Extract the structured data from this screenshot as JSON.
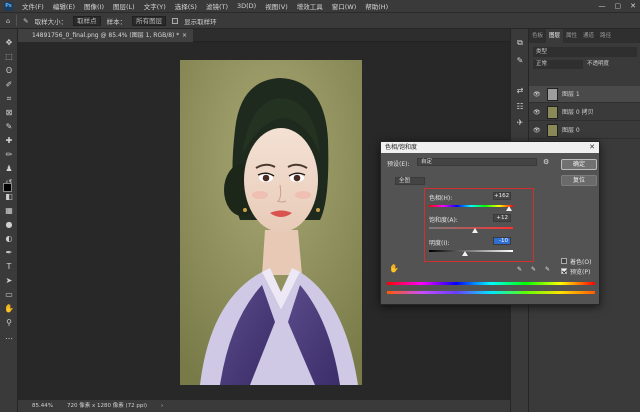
{
  "app": {
    "logo": "Ps"
  },
  "menu": [
    "文件(F)",
    "编辑(E)",
    "图像(I)",
    "图层(L)",
    "文字(Y)",
    "选择(S)",
    "滤镜(T)",
    "3D(D)",
    "视图(V)",
    "增效工具",
    "窗口(W)",
    "帮助(H)"
  ],
  "window_controls": {
    "minimize": "—",
    "maximize": "▢",
    "close": "✕"
  },
  "options_bar": {
    "sample_label": "取样大小：",
    "sample_value": "取样点",
    "sample_label2": "样本：",
    "sample_value2": "所有图层",
    "ring_label": "显示取样环"
  },
  "document_tab": {
    "title": "14891756_0_final.png @ 85.4% (图层 1, RGB/8) *",
    "close": "×"
  },
  "status_bar": {
    "zoom": "85.44%",
    "size": "720 像素 x 1280 像素 (72 ppi)",
    "arrow": "›"
  },
  "right_panel": {
    "tabs": [
      "色板",
      "图层",
      "属性",
      "通道",
      "路径"
    ],
    "active_tab": "图层",
    "filter": {
      "label": "类型",
      "mode": "正常",
      "opacity": "不透明度"
    },
    "layers": [
      {
        "name": "图层 1"
      },
      {
        "name": "图层 0 拷贝"
      },
      {
        "name": "图层 0"
      }
    ]
  },
  "dialog": {
    "title": "色相/饱和度",
    "close": "✕",
    "preset_label": "预设(E):",
    "preset_value": "自定",
    "gear_icon": "⚙",
    "channel_value": "全图",
    "hue_label": "色相(H):",
    "hue_value": "+162",
    "sat_label": "饱和度(A):",
    "sat_value": "+12",
    "light_label": "明度(I):",
    "light_value": "-10",
    "ok_label": "确定",
    "cancel_label": "复位",
    "colorize_label": "着色(O)",
    "preview_label": "预览(P)",
    "colorize_checked": false,
    "preview_checked": true,
    "hand_icon": "✋"
  },
  "colors": {
    "accent_red": "#d23030",
    "selection_blue": "#2f6fd1",
    "panel": "#3a3a3a",
    "canvas_bg": "#282828"
  }
}
